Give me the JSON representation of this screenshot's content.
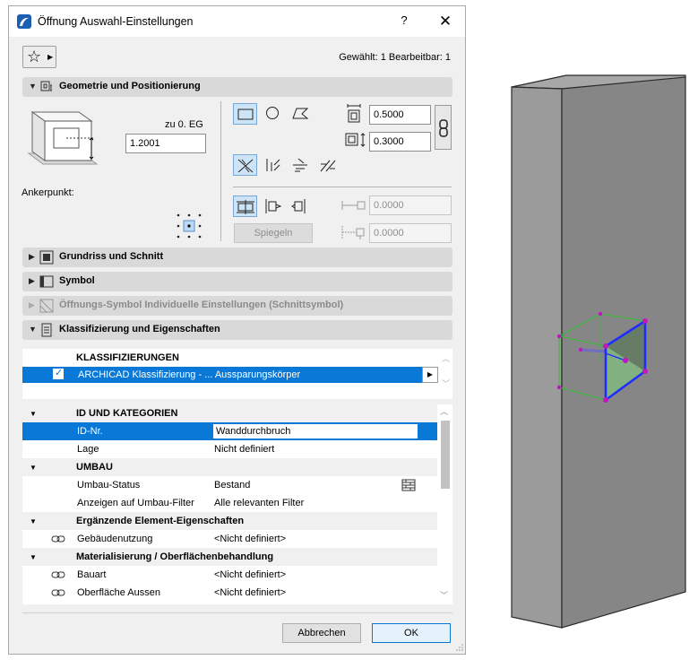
{
  "window": {
    "title": "Öffnung Auswahl-Einstellungen",
    "help": "?",
    "close": "✕"
  },
  "header": {
    "selected_info": "Gewählt: 1 Bearbeitbar: 1"
  },
  "sections": {
    "geometry": "Geometrie und Positionierung",
    "floorplan": "Grundriss und Schnitt",
    "symbol": "Symbol",
    "opening_symbol": "Öffnungs-Symbol Individuelle Einstellungen (Schnittsymbol)",
    "classification": "Klassifizierung und Eigenschaften"
  },
  "geometry": {
    "story_label": "zu 0. EG",
    "elevation": "1.2001",
    "anchor_label": "Ankerpunkt:",
    "width": "0.5000",
    "height": "0.3000",
    "offset1": "0.0000",
    "offset2": "0.0000",
    "mirror_label": "Spiegeln"
  },
  "classification": {
    "header": "KLASSIFIZIERUNGEN",
    "row_text": "ARCHICAD Klassifizierung - ... Aussparungskörper",
    "checked": true
  },
  "properties": {
    "groups": [
      {
        "name": "ID UND KATEGORIEN"
      },
      {
        "name": "UMBAU"
      },
      {
        "name": "Ergänzende Element-Eigenschaften"
      },
      {
        "name": "Materialisierung / Oberflächenbehandlung"
      }
    ],
    "rows": [
      {
        "name": "ID-Nr.",
        "value": "Wanddurchbruch"
      },
      {
        "name": "Lage",
        "value": "Nicht definiert"
      },
      {
        "name": "Umbau-Status",
        "value": "Bestand"
      },
      {
        "name": "Anzeigen auf Umbau-Filter",
        "value": "Alle relevanten Filter"
      },
      {
        "name": "Gebäudenutzung",
        "value": "<Nicht definiert>"
      },
      {
        "name": "Bauart",
        "value": "<Nicht definiert>"
      },
      {
        "name": "Oberfläche Aussen",
        "value": "<Nicht definiert>"
      }
    ]
  },
  "buttons": {
    "cancel": "Abbrechen",
    "ok": "OK"
  },
  "colors": {
    "selection": "#0a78d7",
    "section_header": "#d9d9d9",
    "preview_wall": "#8c8c8c"
  }
}
